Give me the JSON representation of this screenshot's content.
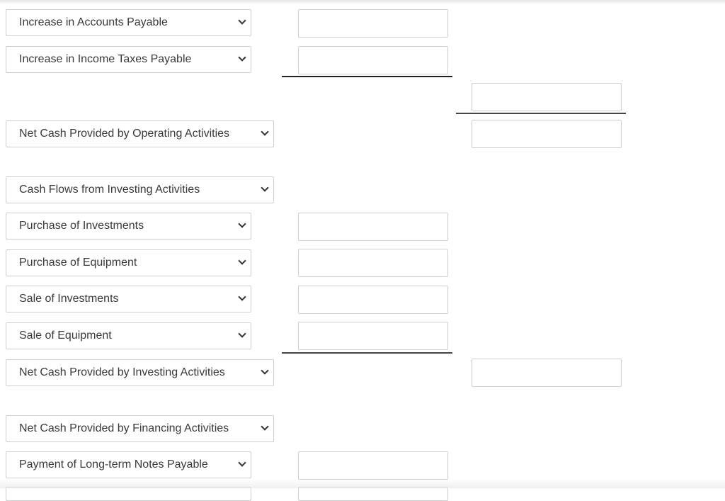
{
  "rows": [
    {
      "label": "Increase in Accounts Payable",
      "amount1": "",
      "amount2": null
    },
    {
      "label": "Increase in Income Taxes Payable",
      "amount1": "",
      "amount2": null
    },
    {
      "label": null,
      "subtotal": ""
    },
    {
      "label": "Net Cash Provided by Operating Activities",
      "amount2": ""
    },
    {
      "label": "Cash Flows from Investing Activities"
    },
    {
      "label": "Purchase of Investments",
      "amount1": ""
    },
    {
      "label": "Purchase of Equipment",
      "amount1": ""
    },
    {
      "label": "Sale of Investments",
      "amount1": ""
    },
    {
      "label": "Sale of Equipment",
      "amount1": ""
    },
    {
      "label": "Net Cash Provided by Investing Activities",
      "amount2": ""
    },
    {
      "label": "Net Cash Provided by Financing Activities"
    },
    {
      "label": "Payment of Long-term Notes Payable",
      "amount1": ""
    }
  ]
}
